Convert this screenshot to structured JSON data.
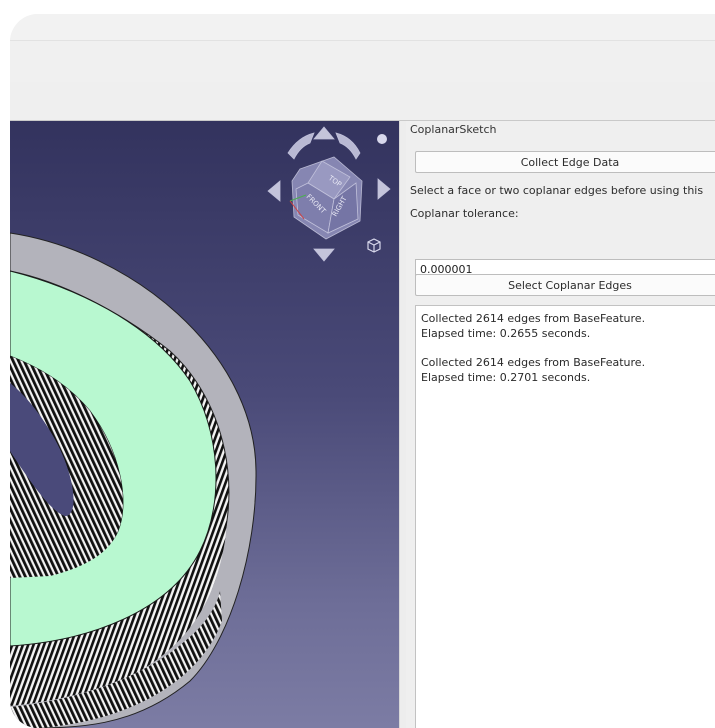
{
  "panel": {
    "title": "CoplanarSketch",
    "collect_button": "Collect Edge Data",
    "instruction": "Select a face or two coplanar edges before using this",
    "tolerance_label": "Coplanar tolerance:",
    "tolerance_value": "0.000001",
    "select_button": "Select Coplanar Edges",
    "log": [
      {
        "line1": "Collected 2614 edges from BaseFeature.",
        "line2": "Elapsed time: 0.2655 seconds."
      },
      {
        "line1": "Collected 2614 edges from BaseFeature.",
        "line2": "Elapsed time: 0.2701 seconds."
      }
    ]
  },
  "navcube": {
    "faces": [
      "TOP",
      "FRONT",
      "RIGHT"
    ]
  },
  "colors": {
    "viewport_top": "#33335e",
    "viewport_bottom": "#7c7ca4",
    "model_face": "#b8f8d0",
    "model_rim": "#b4b4bc",
    "hatch": "#111111"
  }
}
